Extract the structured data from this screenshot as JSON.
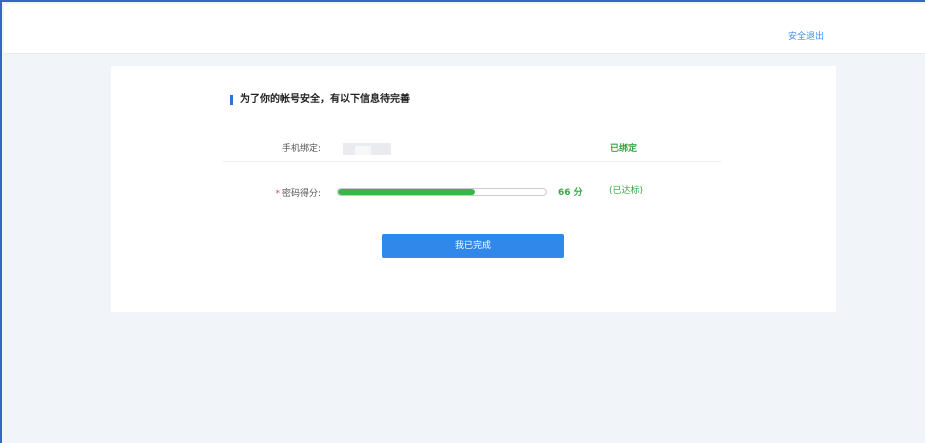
{
  "header": {
    "logout_label": "安全退出"
  },
  "card": {
    "title": "为了你的帐号安全，有以下信息待完善",
    "phone_row": {
      "label": "手机绑定:",
      "status": "已绑定"
    },
    "password_row": {
      "required_mark": "*",
      "label": "密码得分:",
      "score_value": 66,
      "score_text": "66 分",
      "status": "(已达标)",
      "progress_fraction": 0.66
    },
    "done_button_label": "我已完成"
  },
  "colors": {
    "accent_blue": "#3188eb",
    "success_green": "#3aa842",
    "title_bar_blue": "#2f6fd8",
    "required_red": "#e24b4b"
  }
}
